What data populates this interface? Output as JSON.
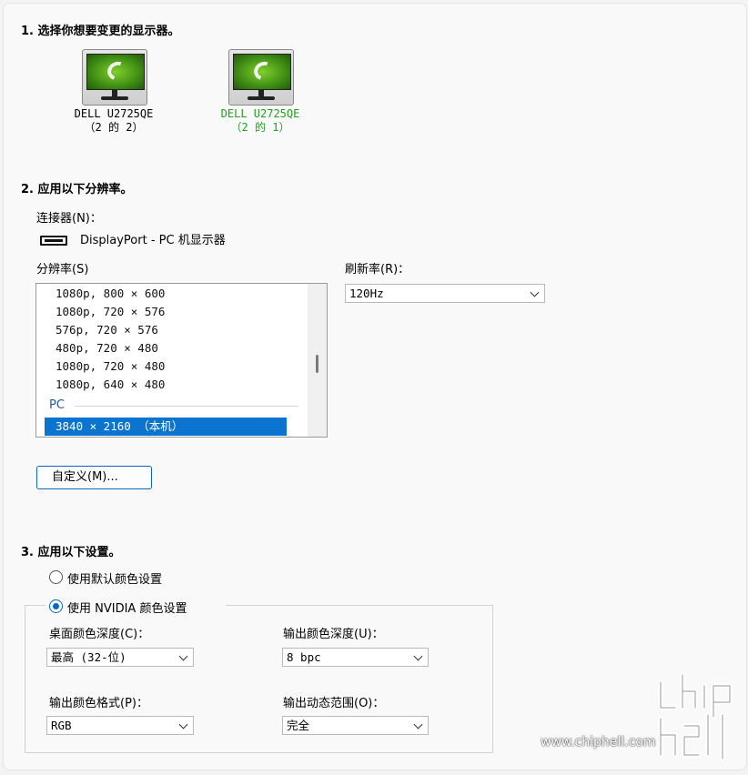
{
  "section1": {
    "heading": "1. 选择你想要变更的显示器。",
    "monitors": [
      {
        "name": "DELL U2725QE",
        "index": "（2 的 2）",
        "active": false
      },
      {
        "name": "DELL U2725QE",
        "index": "（2 的 1）",
        "active": true
      }
    ]
  },
  "section2": {
    "heading": "2. 应用以下分辨率。",
    "connector_label": "连接器(N)：",
    "connector_value": "DisplayPort - PC 机显示器",
    "resolution_label": "分辨率(S)",
    "resolutions": [
      "1080p, 800 × 600",
      "1080p, 720 × 576",
      "576p, 720 × 576",
      "480p, 720 × 480",
      "1080p, 720 × 480",
      "1080p, 640 × 480"
    ],
    "group_label": "PC",
    "selected_resolution": "3840 × 2160 （本机）",
    "refresh_label": "刷新率(R)：",
    "refresh_value": "120Hz",
    "custom_button": "自定义(M)..."
  },
  "section3": {
    "heading": "3. 应用以下设置。",
    "radio_default": "使用默认颜色设置",
    "radio_nvidia": "使用 NVIDIA 颜色设置",
    "selected_radio": "nvidia",
    "desktop_depth_label": "桌面颜色深度(C)：",
    "desktop_depth_value": "最高 (32-位)",
    "output_depth_label": "输出颜色深度(U)：",
    "output_depth_value": "8 bpc",
    "output_format_label": "输出颜色格式(P)：",
    "output_format_value": "RGB",
    "output_range_label": "输出动态范围(O)：",
    "output_range_value": "完全"
  },
  "watermark": {
    "url": "www.chiphell.com",
    "logo_text": "chip hell"
  },
  "colors": {
    "accent": "#0a74d0",
    "active_monitor_text": "#21a021",
    "group_label": "#1e5aa8"
  }
}
